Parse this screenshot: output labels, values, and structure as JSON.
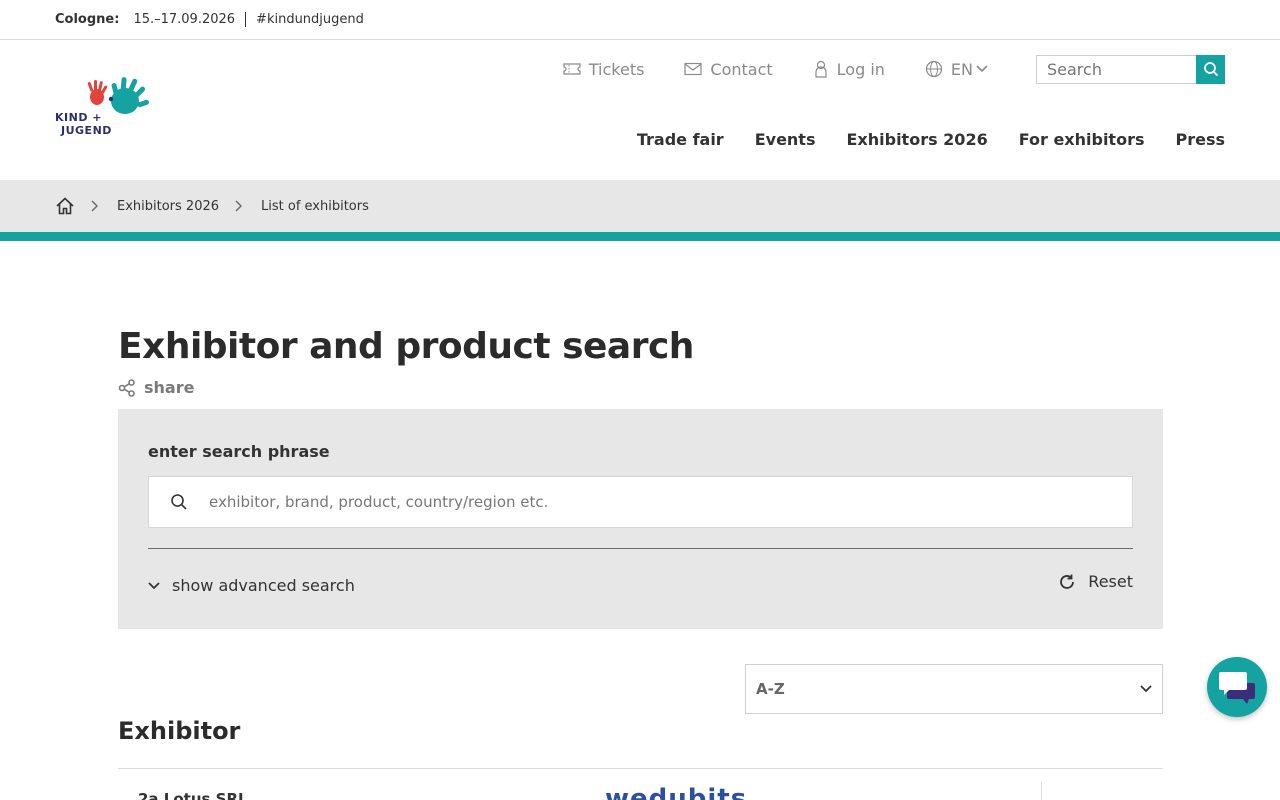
{
  "topbar": {
    "city": "Cologne:",
    "dates": "15.–17.09.2026",
    "hashtag": "#kindundjugend"
  },
  "logo": {
    "line1": "KIND +",
    "line2": "JUGEND"
  },
  "meta_nav": {
    "tickets": "Tickets",
    "contact": "Contact",
    "login": "Log in",
    "language": "EN",
    "search_placeholder": "Search"
  },
  "main_nav": {
    "items": [
      {
        "label": "Trade fair"
      },
      {
        "label": "Events"
      },
      {
        "label": "Exhibitors 2026"
      },
      {
        "label": "For exhibitors"
      },
      {
        "label": "Press"
      }
    ]
  },
  "breadcrumb": {
    "items": [
      {
        "label": "Exhibitors 2026"
      },
      {
        "label": "List of exhibitors"
      }
    ]
  },
  "page": {
    "title": "Exhibitor and product search",
    "share": "share"
  },
  "search_panel": {
    "label": "enter search phrase",
    "placeholder": "exhibitor, brand, product, country/region etc.",
    "advanced": "show advanced search",
    "reset": "Reset"
  },
  "sort": {
    "selected": "A-Z"
  },
  "results": {
    "section_title": "Exhibitor",
    "first_row_name": "2a Lotus SRL",
    "first_row_logo": "wedubits"
  },
  "colors": {
    "accent": "#14a3a0",
    "breadcrumb_bg": "#e7e7e7",
    "panel_bg": "#e7e7e7",
    "text": "#333333"
  }
}
